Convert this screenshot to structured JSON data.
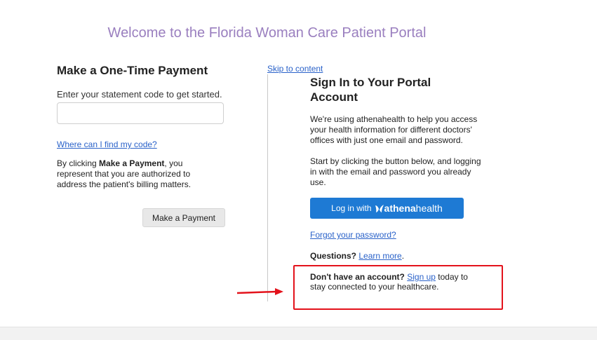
{
  "portal_title": "Welcome to the Florida Woman Care Patient Portal",
  "payment": {
    "heading": "Make a One-Time Payment",
    "instructions": "Enter your statement code to get started.",
    "input_value": "",
    "find_code_link": "Where can I find my code?",
    "disclaimer_prefix": "By clicking ",
    "disclaimer_bold": "Make a Payment",
    "disclaimer_suffix": ", you represent that you are authorized to address the patient's billing matters.",
    "button_label": "Make a Payment"
  },
  "skip_link": "Skip to content",
  "signin": {
    "heading": "Sign In to Your Portal Account",
    "intro": "We're using athenahealth to help you access your health information for different doctors' offices with just one email and password.",
    "start": "Start by clicking the button below, and logging in with the email and password you already use.",
    "login_button_prefix": "Log in with",
    "logo_text_bold": "athena",
    "logo_text_regular": "health",
    "forgot_password": "Forgot your password?",
    "questions_label": "Questions?",
    "learn_more": "Learn more",
    "questions_suffix": ".",
    "signup_bold": "Don't have an account?",
    "signup_link": "Sign up",
    "signup_suffix": " today to stay connected to your healthcare."
  },
  "colors": {
    "title": "#9a7fbf",
    "link": "#2a62c9",
    "athena_button": "#1e7ad4",
    "annotation": "#e3121b"
  },
  "icons": {
    "athena_logo": "athena-leaf-icon",
    "annotation_arrow": "arrow-right-icon"
  }
}
